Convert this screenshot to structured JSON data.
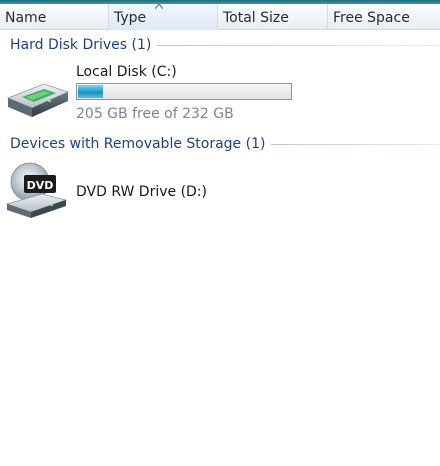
{
  "columns": {
    "name": "Name",
    "type": "Type",
    "total_size": "Total Size",
    "free_space": "Free Space"
  },
  "groups": [
    {
      "title": "Hard Disk Drives (1)",
      "items": [
        {
          "name": "Local Disk (C:)",
          "icon": "hard-disk-icon",
          "usage_fraction": 0.116,
          "free_text": "205 GB free of 232 GB"
        }
      ]
    },
    {
      "title": "Devices with Removable Storage (1)",
      "items": [
        {
          "name": "DVD RW Drive (D:)",
          "icon": "dvd-drive-icon",
          "badge": "DVD"
        }
      ]
    }
  ],
  "colors": {
    "group_title": "#1b3f93",
    "usage_fill": "#2ba7d4",
    "secondary_text": "#7a8594"
  }
}
